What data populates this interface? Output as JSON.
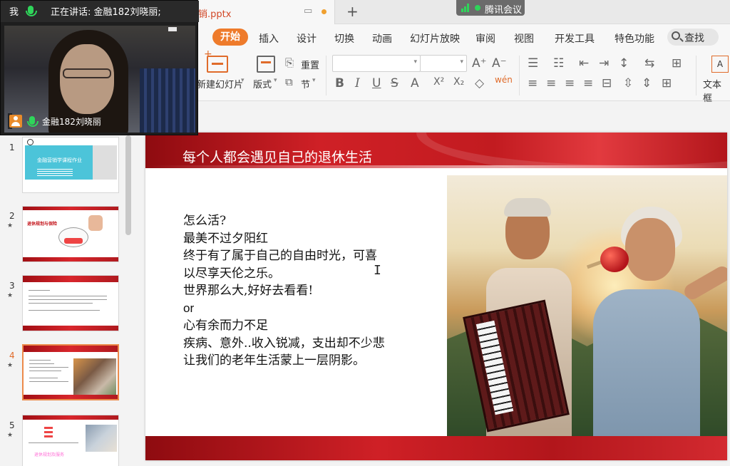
{
  "titlebar": {
    "doc_title": "销.pptx",
    "new_tab": "+",
    "meeting_badge": "腾讯会议"
  },
  "menu": {
    "active": "开始",
    "items": [
      "插入",
      "设计",
      "切换",
      "动画",
      "幻灯片放映",
      "审阅",
      "视图",
      "开发工具",
      "特色功能"
    ],
    "search_label": "查找"
  },
  "toolbar": {
    "new_slide": "新建幻灯片",
    "layout": "版式",
    "reset": "重置",
    "section": "节",
    "textbox": "文本框"
  },
  "video_overlay": {
    "me_label": "我",
    "speaking": "正在讲话: 金融182刘晓丽;",
    "participant_name": "金融182刘晓丽"
  },
  "thumbnails": {
    "numbers": [
      "1",
      "2",
      "3",
      "4",
      "5"
    ],
    "selected": 4,
    "thumb1_title": "金融营销学课程作业",
    "thumb2_title": "退休规划与保险",
    "thumb5_footer": "退休规划及服务"
  },
  "slide": {
    "title": "每个人都会遇见自己的退休生活",
    "lines": [
      "怎么活?",
      "最美不过夕阳红",
      "终于有了属于自己的自由时光，可喜",
      "以尽享天伦之乐。",
      "世界那么大,好好去看看!",
      "or",
      "心有余而力不足",
      "疾病、意外..收入锐减，支出却不少悲",
      "让我们的老年生活蒙上一层阴影。"
    ],
    "colors": {
      "header_red": "#c21b20",
      "accent_orange": "#ee7b2b"
    }
  }
}
